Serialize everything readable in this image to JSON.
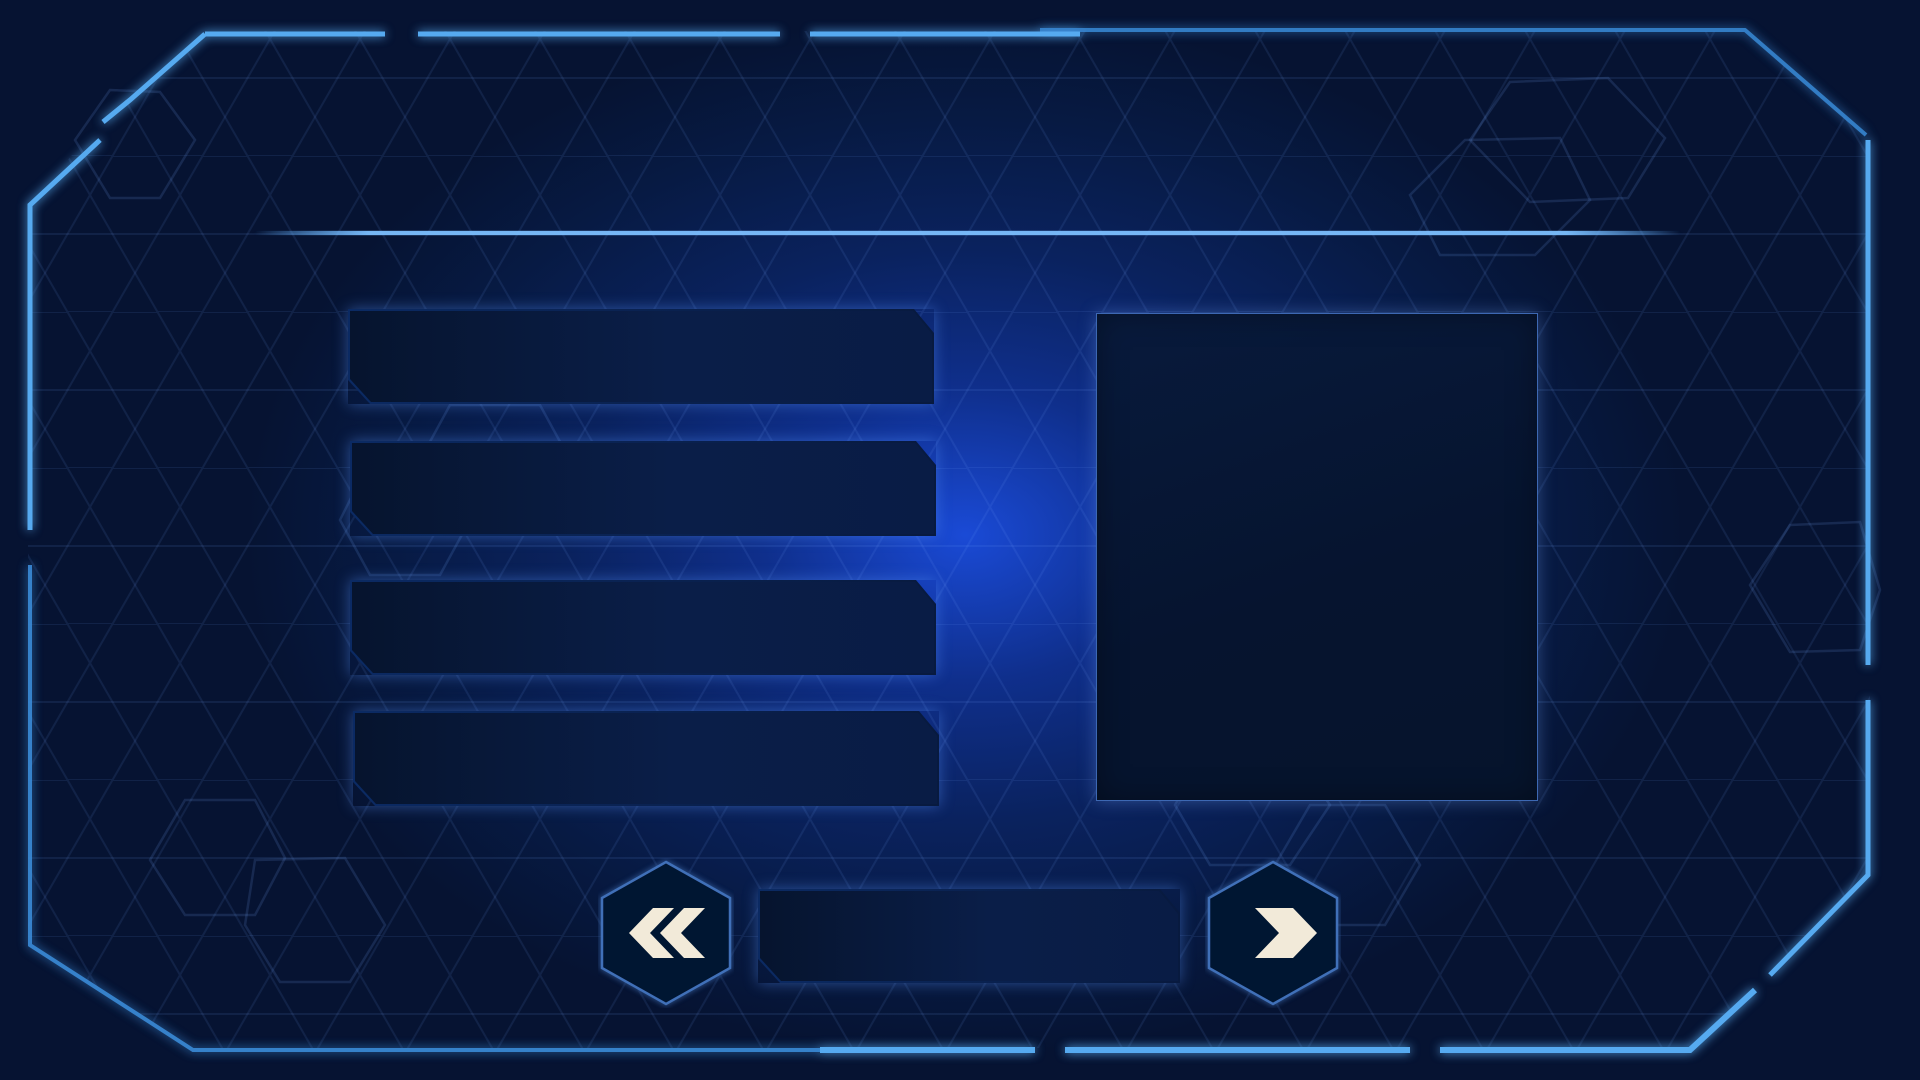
{
  "theme": {
    "accent": "#5fb0ff",
    "frame_glow": "#4aa8ff",
    "panel_fill": "#061430",
    "arrow_color": "#f2ead9"
  },
  "menu": {
    "slots": [
      {
        "label": ""
      },
      {
        "label": ""
      },
      {
        "label": ""
      },
      {
        "label": ""
      }
    ]
  },
  "preview": {
    "caption": ""
  },
  "pager": {
    "prev_icon": "double-chevron-left-icon",
    "next_icon": "double-chevron-right-icon",
    "page_label": ""
  }
}
